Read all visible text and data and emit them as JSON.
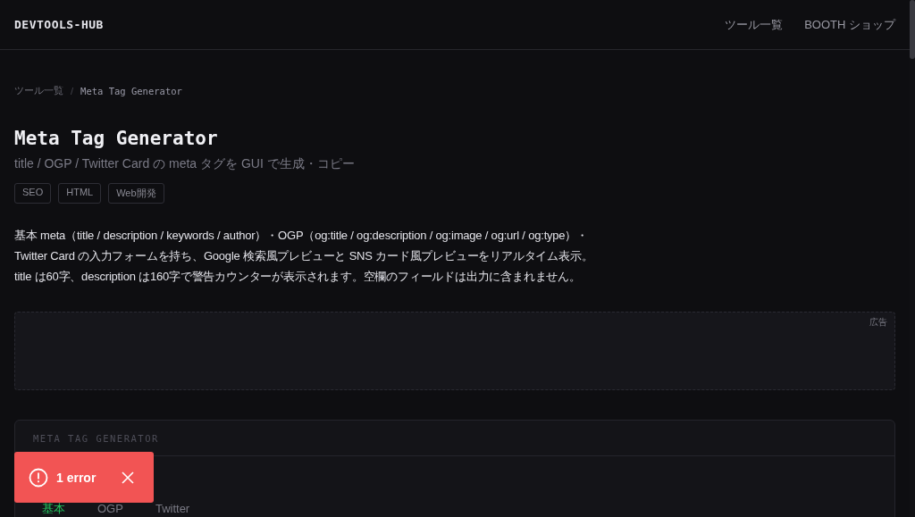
{
  "header": {
    "logo": "DEVTOOLS-HUB",
    "nav": [
      "ツール一覧",
      "BOOTH ショップ"
    ]
  },
  "breadcrumb": {
    "parent": "ツール一覧",
    "separator": "/",
    "current": "Meta Tag Generator"
  },
  "title": "Meta Tag Generator",
  "subtitle": "title / OGP / Twitter Card の meta タグを GUI で生成・コピー",
  "tags": [
    "SEO",
    "HTML",
    "Web開発"
  ],
  "description": "基本 meta（title / description / keywords / author）・OGP（og:title / og:description / og:image / og:url / og:type）・Twitter Card の入力フォームを持ち、Google 検索風プレビューと SNS カード風プレビューをリアルタイム表示。title は60字、description は160字で警告カウンターが表示されます。空欄のフィールドは出力に含まれません。",
  "ad": {
    "label": "広告"
  },
  "tool_panel": {
    "heading": "META TAG GENERATOR",
    "tabs": [
      {
        "label": "基本",
        "selected": true
      },
      {
        "label": "OGP",
        "selected": false
      },
      {
        "label": "Twitter",
        "selected": false
      }
    ]
  },
  "error_toast": {
    "text": "1 error"
  }
}
